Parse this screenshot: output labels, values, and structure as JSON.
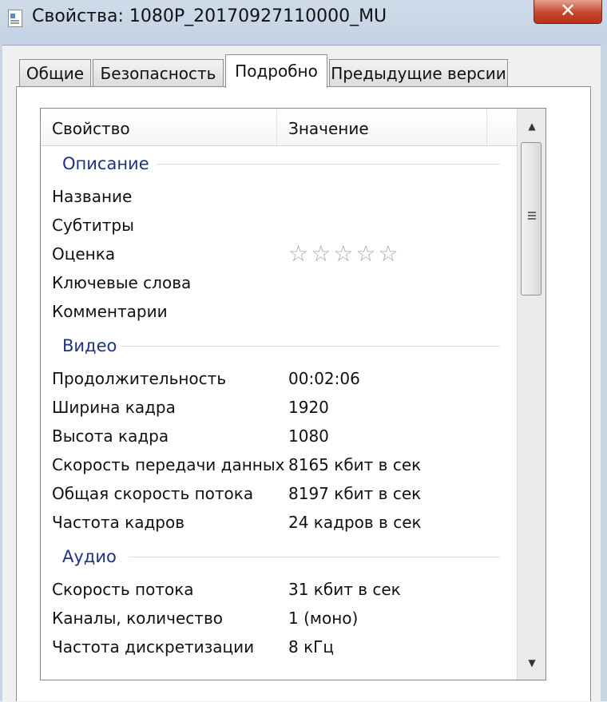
{
  "window": {
    "title": "Свойства: 1080P_20170927110000_MU",
    "close_symbol": "✕"
  },
  "tabs": [
    {
      "label": "Общие"
    },
    {
      "label": "Безопасность"
    },
    {
      "label": "Подробно"
    },
    {
      "label": "Предыдущие версии"
    }
  ],
  "active_tab": "Подробно",
  "columns": {
    "property": "Свойство",
    "value": "Значение"
  },
  "groups": {
    "description": {
      "label": "Описание",
      "rows": [
        {
          "property": "Название",
          "value": ""
        },
        {
          "property": "Субтитры",
          "value": ""
        },
        {
          "property": "Оценка",
          "value": ""
        },
        {
          "property": "Ключевые слова",
          "value": ""
        },
        {
          "property": "Комментарии",
          "value": ""
        }
      ]
    },
    "video": {
      "label": "Видео",
      "rows": [
        {
          "property": "Продолжительность",
          "value": "00:02:06"
        },
        {
          "property": "Ширина кадра",
          "value": "1920"
        },
        {
          "property": "Высота кадра",
          "value": "1080"
        },
        {
          "property": "Скорость передачи данных",
          "value": "8165 кбит в сек"
        },
        {
          "property": "Общая скорость потока",
          "value": "8197 кбит в сек"
        },
        {
          "property": "Частота кадров",
          "value": "24 кадров в сек"
        }
      ]
    },
    "audio": {
      "label": "Аудио",
      "rows": [
        {
          "property": "Скорость потока",
          "value": "31 кбит в сек"
        },
        {
          "property": "Каналы, количество",
          "value": "1 (моно)"
        },
        {
          "property": "Частота дискретизации",
          "value": "8 кГц"
        }
      ]
    }
  },
  "rating": {
    "stars_total": 5,
    "stars_filled": 0,
    "star_glyph": "☆"
  },
  "scrollbar": {
    "up_arrow": "▲",
    "down_arrow": "▼"
  },
  "colors": {
    "group_header": "#1e3287",
    "close_button": "#c6452c"
  }
}
